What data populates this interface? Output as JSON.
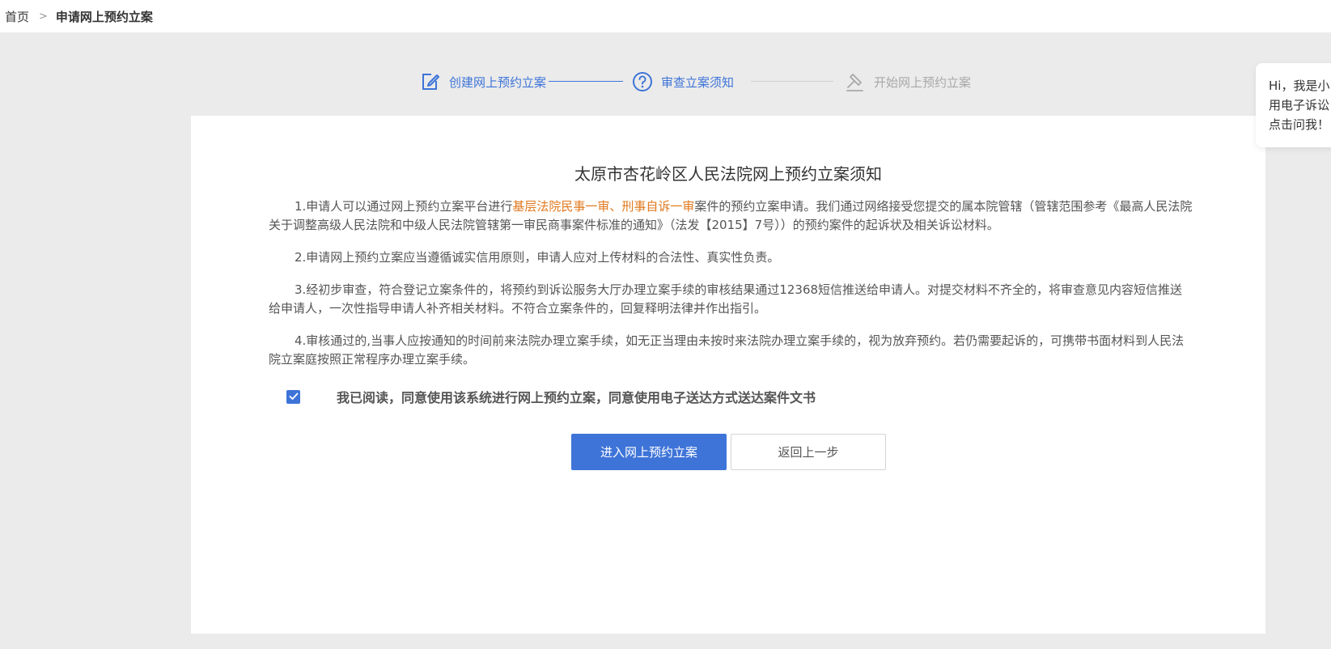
{
  "breadcrumb": {
    "home": "首页",
    "separator": ">",
    "current": "申请网上预约立案"
  },
  "steps": [
    {
      "label": "创建网上预约立案",
      "icon": "edit-icon",
      "state": "done"
    },
    {
      "label": "审查立案须知",
      "icon": "question-circle-icon",
      "state": "active"
    },
    {
      "label": "开始网上预约立案",
      "icon": "gavel-icon",
      "state": "pending"
    }
  ],
  "notice": {
    "title": "太原市杏花岭区人民法院网上预约立案须知",
    "p1_before": "1.申请人可以通过网上预约立案平台进行",
    "p1_highlight": "基层法院民事一审、刑事自诉一审",
    "p1_after": "案件的预约立案申请。我们通过网络接受您提交的属本院管辖（管辖范围参考《最高人民法院关于调整高级人民法院和中级人民法院管辖第一审民商事案件标准的通知》（法发【2015】7号））的预约案件的起诉状及相关诉讼材料。",
    "p2": "2.申请网上预约立案应当遵循诚实信用原则，申请人应对上传材料的合法性、真实性负责。",
    "p3": "3.经初步审查，符合登记立案条件的，将预约到诉讼服务大厅办理立案手续的审核结果通过12368短信推送给申请人。对提交材料不齐全的，将审查意见内容短信推送给申请人，一次性指导申请人补齐相关材料。不符合立案条件的，回复释明法律并作出指引。",
    "p4": "4.审核通过的,当事人应按通知的时间前来法院办理立案手续，如无正当理由未按时来法院办理立案手续的，视为放弃预约。若仍需要起诉的，可携带书面材料到人民法院立案庭按照正常程序办理立案手续。"
  },
  "agreement": {
    "checked": true,
    "label": "我已阅读，同意使用该系统进行网上预约立案，同意使用电子送达方式送达案件文书"
  },
  "buttons": {
    "enter": "进入网上预约立案",
    "back": "返回上一步"
  },
  "helper": {
    "line1": "Hi，我是小",
    "line2": "用电子诉讼",
    "line3": "点击问我！"
  },
  "colors": {
    "accent": "#3e74d8",
    "highlight": "#e07a1f",
    "pending": "#a8a8a8",
    "background": "#ebebeb"
  }
}
